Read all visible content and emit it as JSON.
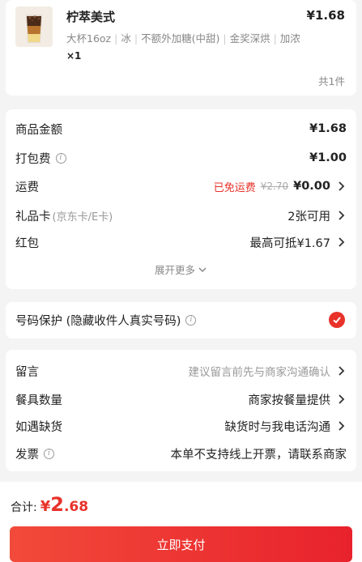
{
  "product": {
    "name": "柠萃美式",
    "price": "¥1.68",
    "specs": [
      "大杯16oz",
      "冰",
      "不额外加糖(中甜)",
      "金奖深烘",
      "加浓"
    ],
    "qty": "×1",
    "total_count": "共1件"
  },
  "cost": {
    "goods_label": "商品金额",
    "goods_value": "¥1.68",
    "pack_label": "打包费",
    "pack_value": "¥1.00",
    "ship_label": "运费",
    "ship_free": "已免运费",
    "ship_orig": "¥2.70",
    "ship_value": "¥0.00",
    "gift_label": "礼品卡",
    "gift_sub": "(京东卡/E卡)",
    "gift_value": "2张可用",
    "redpack_label": "红包",
    "redpack_value": "最高可抵¥1.67",
    "expand": "展开更多"
  },
  "privacy": {
    "label": "号码保护 (隐藏收件人真实号码)",
    "checked": true
  },
  "notes": {
    "remark_label": "留言",
    "remark_value": "建议留言前先与商家沟通确认",
    "utensil_label": "餐具数量",
    "utensil_value": "商家按餐量提供",
    "oos_label": "如遇缺货",
    "oos_value": "缺货时与我电话沟通",
    "invoice_label": "发票",
    "invoice_value": "本单不支持线上开票，请联系商家"
  },
  "footer": {
    "total_label": "合计:",
    "currency": "¥",
    "total_int": "2",
    "total_dec": ".68",
    "pay_label": "立即支付"
  },
  "colors": {
    "accent": "#e8322a"
  }
}
